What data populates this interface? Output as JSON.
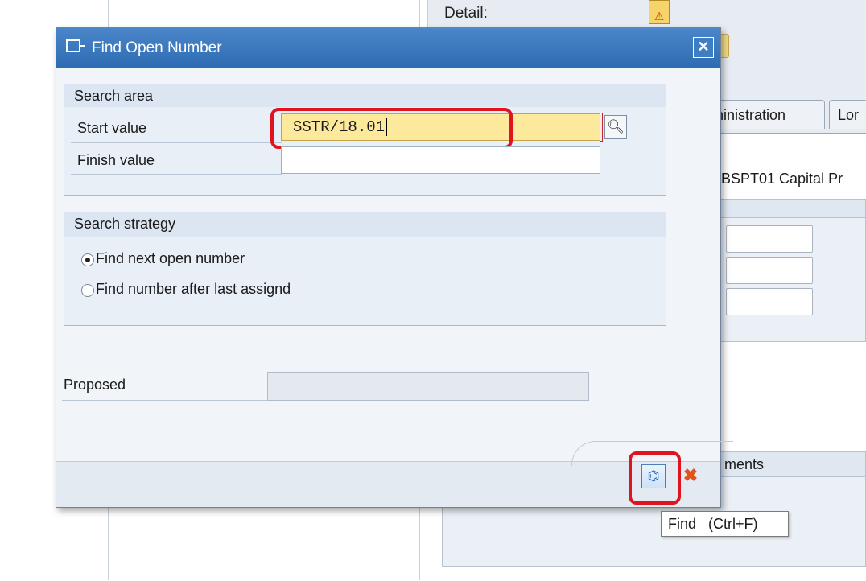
{
  "background": {
    "detail_label": "Detail:",
    "tab_partial": "ninistration",
    "tab_partial2": "Lor",
    "project_text": "BSPT01 Capital Pr",
    "group_partial_label": "ments"
  },
  "dialog": {
    "title": "Find Open Number",
    "close_symbol": "✕",
    "search_area": {
      "header": "Search area",
      "start_label": "Start value",
      "start_value": "SSTR/18.01",
      "finish_label": "Finish value",
      "finish_value": ""
    },
    "search_strategy": {
      "header": "Search strategy",
      "options": [
        {
          "label": "Find next open number",
          "selected": true
        },
        {
          "label": "Find number after last assignd",
          "selected": false
        }
      ]
    },
    "proposed": {
      "label": "Proposed",
      "value": ""
    },
    "buttons": {
      "find_icon": "binoculars-icon",
      "cancel_icon": "cancel-icon"
    },
    "tooltip": "Find   (Ctrl+F)"
  },
  "colors": {
    "title_bar": "#3a78bf",
    "active_input": "#fde99c",
    "highlight": "#e0141e"
  }
}
